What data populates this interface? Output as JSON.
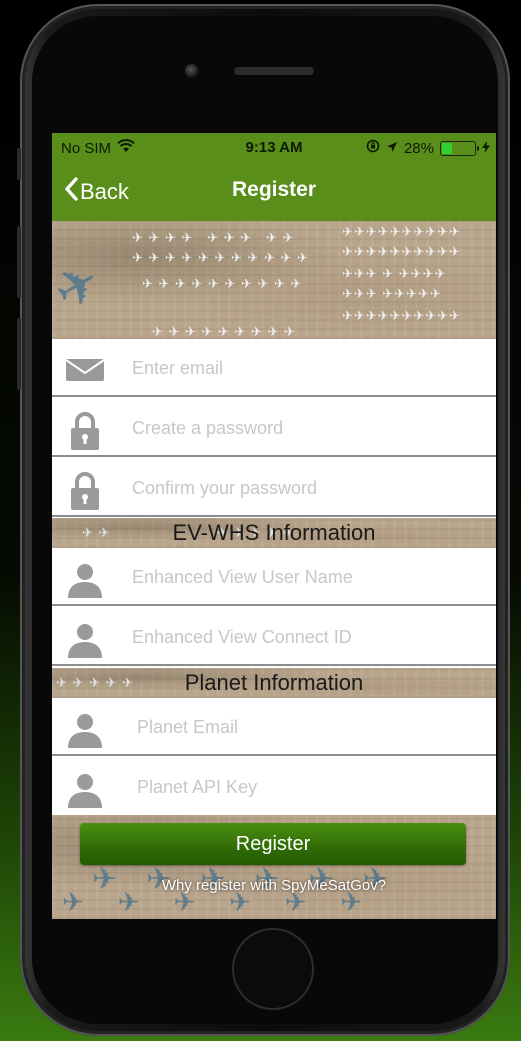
{
  "status_bar": {
    "carrier": "No SIM",
    "time": "9:13 AM",
    "battery": "28%",
    "battery_level": 0.28,
    "icons": [
      "wifi-icon",
      "lock-rotation-icon",
      "location-arrow-icon",
      "battery-icon",
      "charging-icon"
    ]
  },
  "nav": {
    "back_label": "Back",
    "title": "Register"
  },
  "account_fields": [
    {
      "placeholder": "Enter email",
      "icon": "envelope-icon"
    },
    {
      "placeholder": "Create a password",
      "icon": "lock-icon"
    },
    {
      "placeholder": "Confirm your password",
      "icon": "lock-icon"
    }
  ],
  "ev_section": {
    "title": "EV-WHS Information",
    "fields": [
      {
        "placeholder": "Enhanced View User Name",
        "icon": "person-icon"
      },
      {
        "placeholder": "Enhanced View Connect ID",
        "icon": "person-icon"
      }
    ]
  },
  "planet_section": {
    "title": "Planet Information",
    "fields": [
      {
        "placeholder": "Planet Email",
        "icon": "person-icon"
      },
      {
        "placeholder": "Planet API Key",
        "icon": "person-icon"
      }
    ]
  },
  "actions": {
    "register_label": "Register",
    "why_link": "Why register with SpyMeSatGov?"
  },
  "colors": {
    "brand_green": "#5a8e1a",
    "button_green": "#2f6b06",
    "icon_gray": "#9a9a9a",
    "placeholder_gray": "#c7c7c7"
  }
}
